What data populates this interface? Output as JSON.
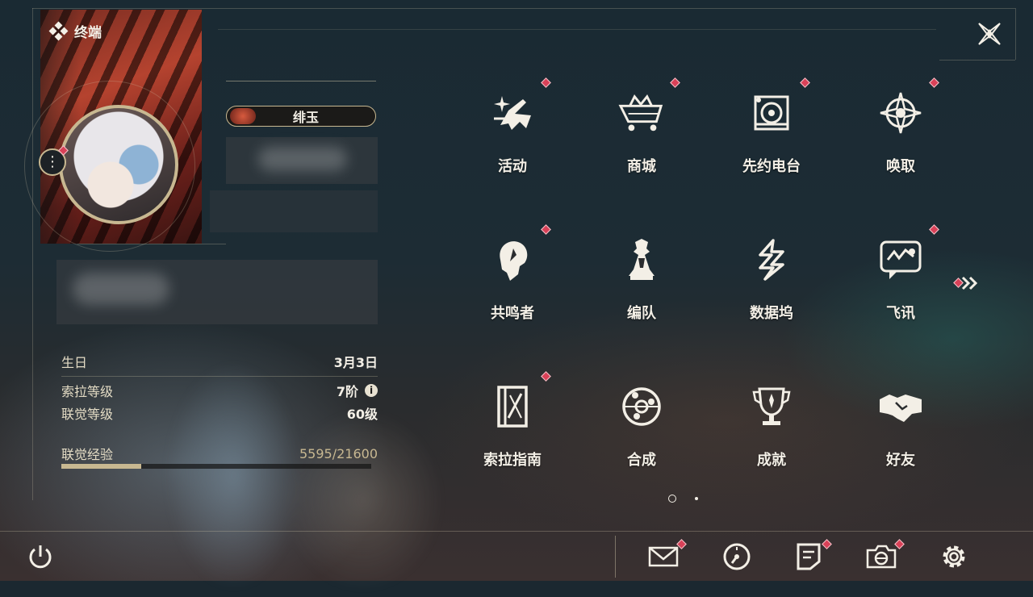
{
  "header": {
    "title": "终端"
  },
  "profile": {
    "name": "绯玉",
    "birthday_label": "生日",
    "birthday_value": "3月3日",
    "sola_level_label": "索拉等级",
    "sola_level_value": "7阶",
    "union_level_label": "联觉等级",
    "union_level_value": "60级",
    "union_exp_label": "联觉经验",
    "union_exp_value": "5595/21600",
    "union_exp_progress": 0.259
  },
  "menu": {
    "items": [
      {
        "label": "活动",
        "icon": "sparkle-icon",
        "badge": true
      },
      {
        "label": "商城",
        "icon": "shopping-cart-icon",
        "badge": true
      },
      {
        "label": "先约电台",
        "icon": "radio-icon",
        "badge": true
      },
      {
        "label": "唤取",
        "icon": "compass-icon",
        "badge": true
      },
      {
        "label": "共鸣者",
        "icon": "character-head-icon",
        "badge": true
      },
      {
        "label": "编队",
        "icon": "chess-piece-icon",
        "badge": false
      },
      {
        "label": "数据坞",
        "icon": "data-dock-icon",
        "badge": false
      },
      {
        "label": "飞讯",
        "icon": "chat-bubble-icon",
        "badge": true
      },
      {
        "label": "索拉指南",
        "icon": "guide-book-icon",
        "badge": true
      },
      {
        "label": "合成",
        "icon": "synthesis-icon",
        "badge": false
      },
      {
        "label": "成就",
        "icon": "trophy-icon",
        "badge": false
      },
      {
        "label": "好友",
        "icon": "handshake-icon",
        "badge": false
      }
    ],
    "page_count": 2,
    "current_page": 1
  },
  "bottom_bar": {
    "items": [
      {
        "icon": "mail-icon",
        "badge": true
      },
      {
        "icon": "clock-icon",
        "badge": false
      },
      {
        "icon": "notice-icon",
        "badge": true
      },
      {
        "icon": "camera-icon",
        "badge": true
      },
      {
        "icon": "settings-gear-icon",
        "badge": false
      }
    ]
  },
  "colors": {
    "accent_gold": "#c8b891",
    "badge_red": "#d94158",
    "text_primary": "#f3efe6"
  }
}
